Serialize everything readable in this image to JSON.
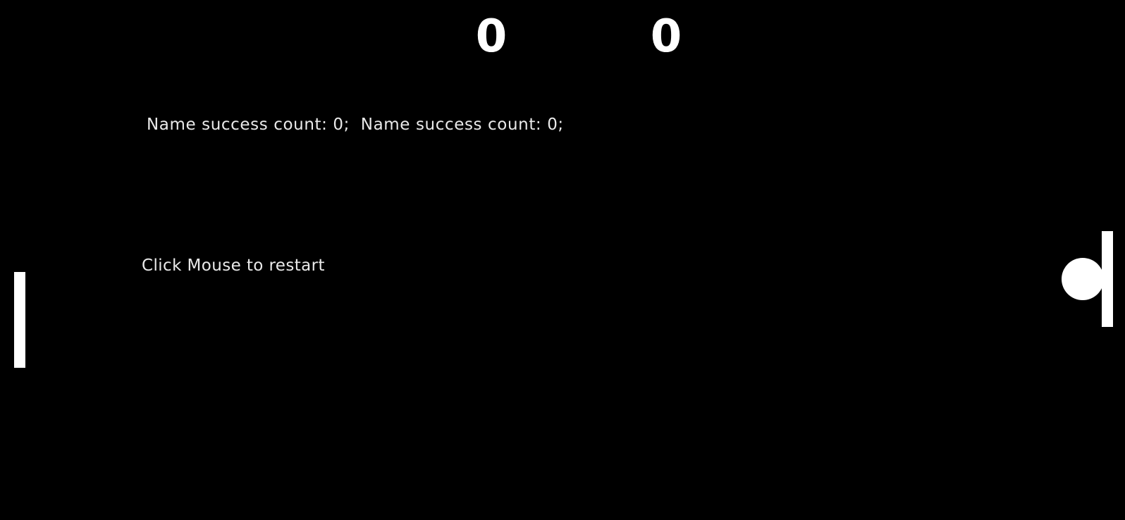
{
  "scores": {
    "left": "0",
    "right": "0"
  },
  "status": {
    "success_line": "Name success count: 0;  Name success count: 0;",
    "restart_message": "Click Mouse to restart"
  },
  "colors": {
    "background": "#000000",
    "foreground": "#ffffff"
  }
}
